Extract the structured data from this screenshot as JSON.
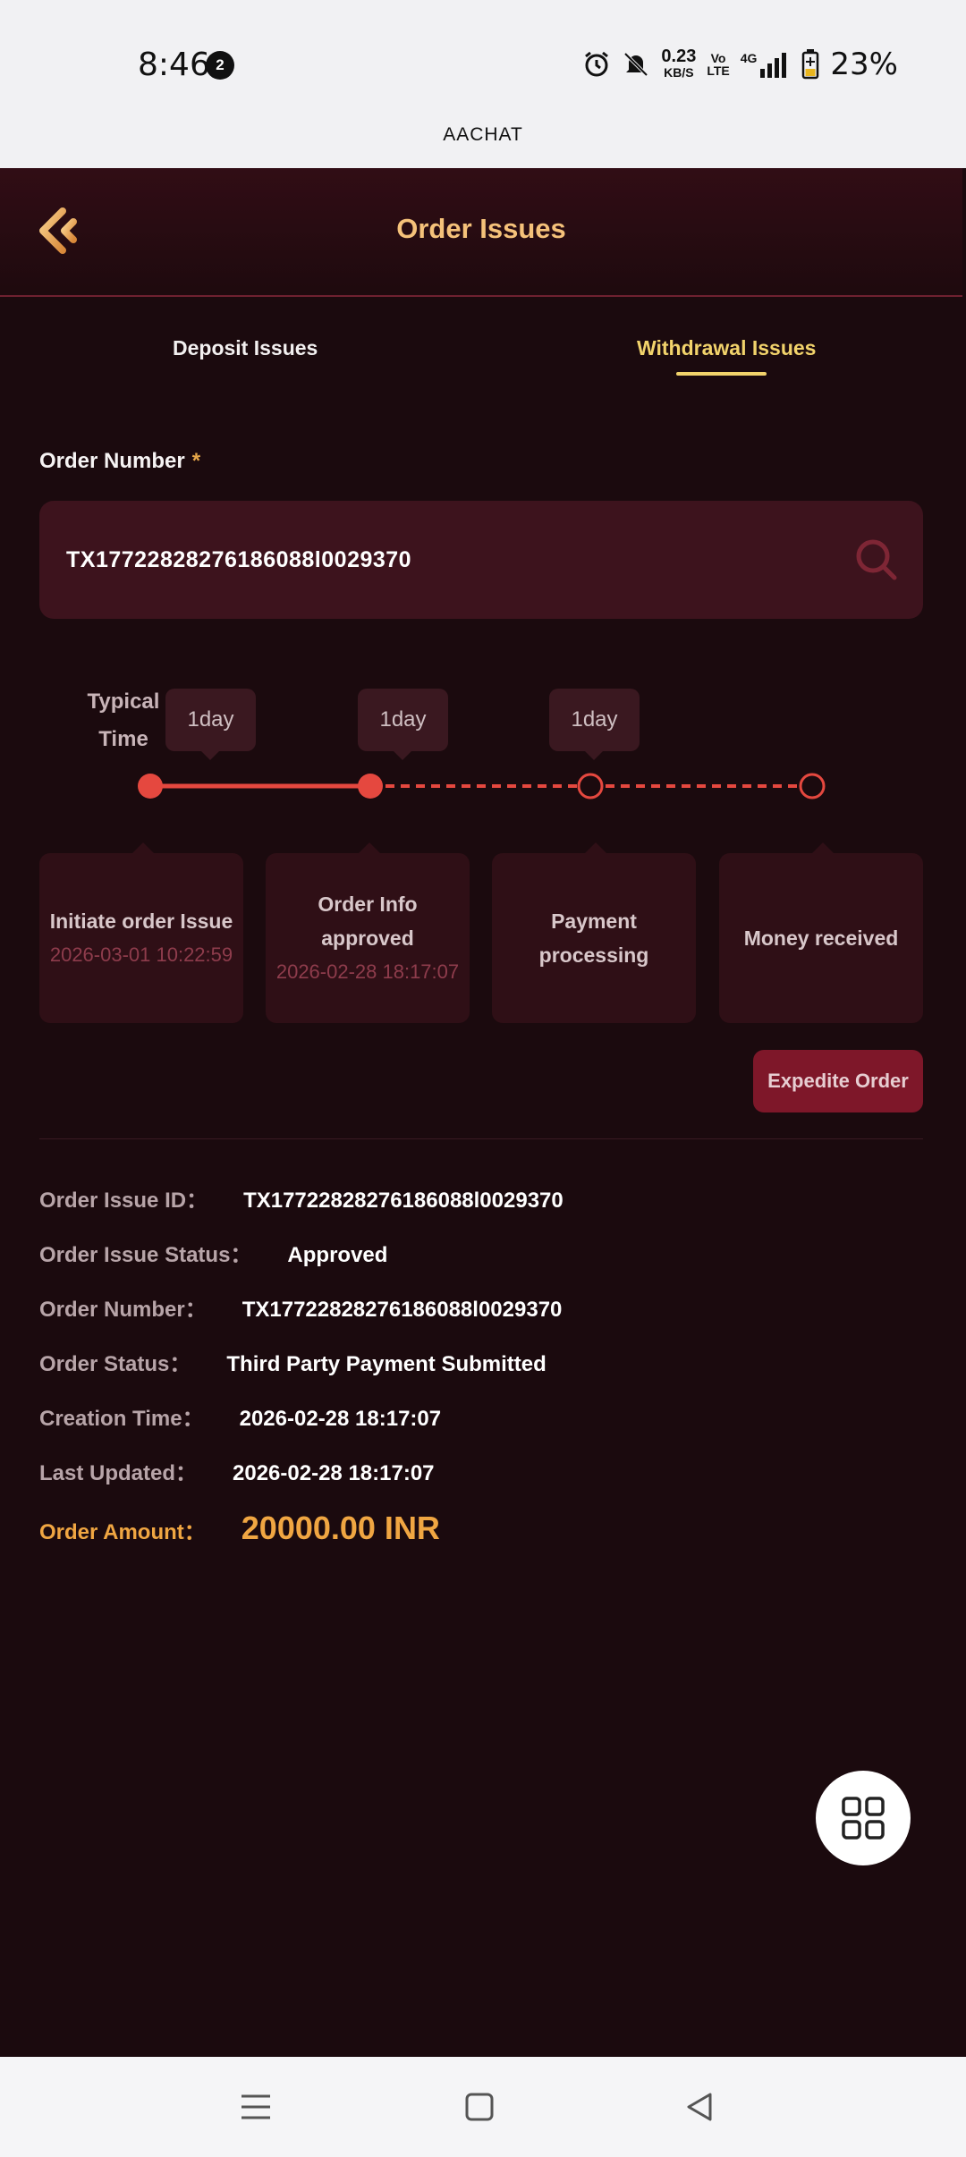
{
  "status_bar": {
    "time": "8:46",
    "notification_count": "2",
    "net_speed": "0.23",
    "net_unit": "KB/S",
    "volte": "Vo\nLTE",
    "network": "4G",
    "battery": "23%"
  },
  "app_title": "AACHAT",
  "header": {
    "title": "Order Issues"
  },
  "tabs": [
    {
      "label": "Deposit Issues",
      "active": false
    },
    {
      "label": "Withdrawal Issues",
      "active": true
    }
  ],
  "form": {
    "order_label": "Order Number",
    "required_mark": "*",
    "order_value": "TX17722828276186088l0029370"
  },
  "timeline": {
    "typical_label": "Typical Time",
    "durations": [
      "1day",
      "1day",
      "1day"
    ],
    "steps": [
      {
        "title": "Initiate order Issue",
        "date": "2026-03-01 10:22:59",
        "done": true
      },
      {
        "title": "Order Info approved",
        "date": "2026-02-28 18:17:07",
        "done": true
      },
      {
        "title": "Payment processing",
        "date": "",
        "done": false
      },
      {
        "title": "Money received",
        "date": "",
        "done": false
      }
    ]
  },
  "expedite_label": "Expedite Order",
  "details": [
    {
      "key": "Order Issue ID：",
      "value": "TX17722828276186088l0029370"
    },
    {
      "key": "Order Issue Status：",
      "value": "Approved"
    },
    {
      "key": "Order Number：",
      "value": "TX17722828276186088l0029370"
    },
    {
      "key": "Order Status：",
      "value": "Third Party Payment Submitted"
    },
    {
      "key": "Creation Time：",
      "value": "2026-02-28 18:17:07"
    },
    {
      "key": "Last Updated：",
      "value": "2026-02-28 18:17:07"
    }
  ],
  "amount": {
    "key": "Order Amount：",
    "value": "20000.00 INR"
  },
  "colors": {
    "accent_gold": "#f5c27a",
    "tab_active": "#f2d36b",
    "timeline_red": "#e5483f",
    "amount_orange": "#f0a642",
    "background": "#1b0a0e"
  },
  "icons": {
    "back": "back-chevron-icon",
    "search": "search-icon",
    "fab": "grid-menu-icon",
    "nav": [
      "menu-icon",
      "home-square-icon",
      "back-triangle-icon"
    ]
  }
}
